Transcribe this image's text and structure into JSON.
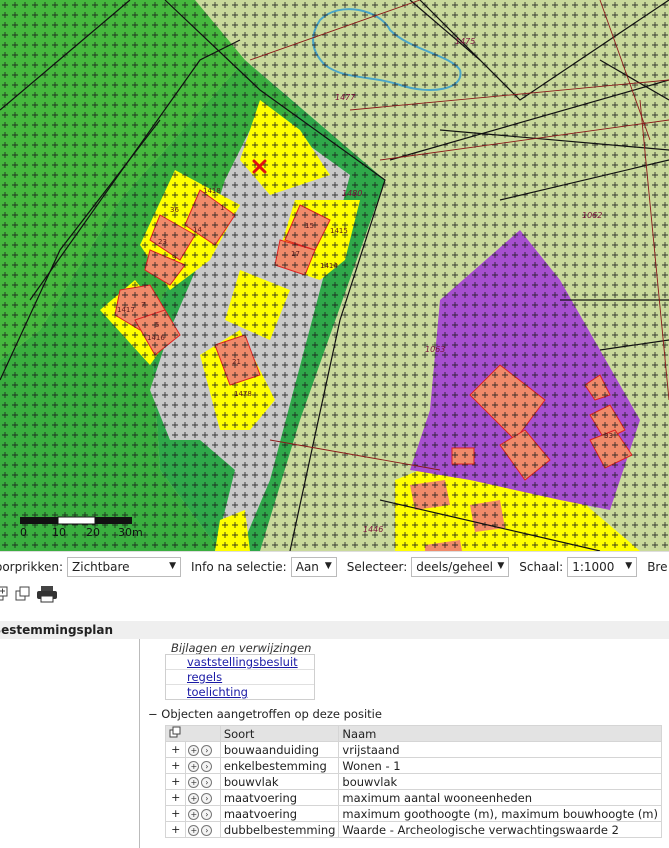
{
  "map": {
    "parcel_numbers": [
      "1418",
      "1",
      "36",
      "14",
      "23",
      "9",
      "1417",
      "7",
      "5",
      "1416",
      "15",
      "17",
      "1415",
      "1414",
      "21",
      "1478",
      "33"
    ],
    "plot_numbers": [
      "1475",
      "1477",
      "1480",
      "1062",
      "1063",
      "1446"
    ],
    "scale_bar": {
      "labels": [
        "0",
        "10",
        "20",
        "30m"
      ]
    }
  },
  "toolbar": {
    "doorprikken_label": "oorprikken:",
    "doorprikken_value": "Zichtbare",
    "info_label": "Info na selectie:",
    "info_value": "Aan",
    "selecteer_label": "Selecteer:",
    "selecteer_value": "deels/geheel",
    "schaal_label": "Schaal:",
    "schaal_value": "1:1000",
    "extra_label": "Bre"
  },
  "panel": {
    "header": "Bestemmingsplan",
    "bijlagen_title": "Bijlagen en verwijzingen",
    "links": [
      "vaststellingsbesluit",
      "regels",
      "toelichting"
    ],
    "objects_title": "−  Objecten aangetroffen op deze positie",
    "columns": {
      "soort": "Soort",
      "naam": "Naam"
    },
    "rows": [
      {
        "soort": "bouwaanduiding",
        "naam": "vrijstaand"
      },
      {
        "soort": "enkelbestemming",
        "naam": "Wonen - 1"
      },
      {
        "soort": "bouwvlak",
        "naam": "bouwvlak"
      },
      {
        "soort": "maatvoering",
        "naam": "maximum aantal wooneenheden"
      },
      {
        "soort": "maatvoering",
        "naam": "maximum goothoogte (m), maximum bouwhoogte (m)"
      },
      {
        "soort": "dubbelbestemming",
        "naam": "Waarde - Archeologische verwachtingswaarde 2"
      }
    ]
  },
  "colors": {
    "agrarisch": "#c9d99b",
    "groen": "#3bb54a",
    "wonen": "#ffff00",
    "bouwvlak": "#f08a6a",
    "verkeer": "#c8c8c8",
    "maatschappelijk": "#a64fcf"
  }
}
